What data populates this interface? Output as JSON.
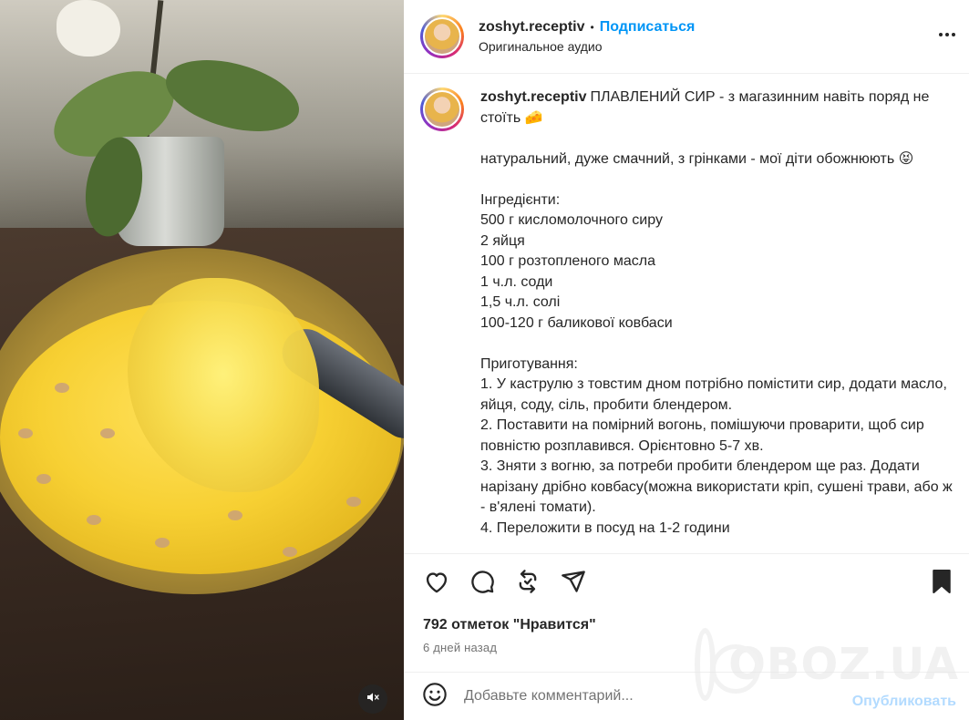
{
  "header": {
    "username": "zoshyt.receptiv",
    "separator": "•",
    "follow_label": "Подписаться",
    "audio_label": "Оригинальное аудио"
  },
  "caption": {
    "username": "zoshyt.receptiv",
    "text": "ПЛАВЛЕНИЙ СИР - з магазинним навіть поряд не стоїть 🧀\n\nнатуральний, дуже смачний, з грінками - мої діти обожнюють 😝\n\nІнгредієнти:\n500 г кисломолочного сиру\n2 яйця\n100 г розтопленого масла\n1 ч.л. соди\n1,5 ч.л. солі\n100-120 г баликової ковбаси\n\nПриготування:\n1. У каструлю з товстим дном потрібно помістити сир, додати масло, яйця, соду, сіль, пробити блендером.\n2. Поставити на помірний вогонь, помішуючи проварити, щоб сир повністю розплавився. Орієнтовно 5-7 хв.\n3. Зняти з вогню, за потреби пробити блендером ще раз. Додати нарізану дрібно ковбасу(можна використати кріп, сушені трави, або ж - в'ялені томати).\n4. Переложити в посуд на 1-2 години"
  },
  "actions": {
    "like_icon": "heart-icon",
    "comment_icon": "comment-icon",
    "repost_icon": "repost-icon",
    "share_icon": "share-icon",
    "save_icon": "bookmark-filled-icon"
  },
  "stats": {
    "likes": "792 отметок \"Нравится\"",
    "time": "6 дней назад"
  },
  "comment": {
    "placeholder": "Добавьте комментарий...",
    "publish_label": "Опубликовать"
  },
  "watermark": {
    "text": "OBOZ.UA"
  },
  "colors": {
    "accent": "#0095f6",
    "publish_disabled": "#b3dbff",
    "muted_text": "#737373"
  }
}
